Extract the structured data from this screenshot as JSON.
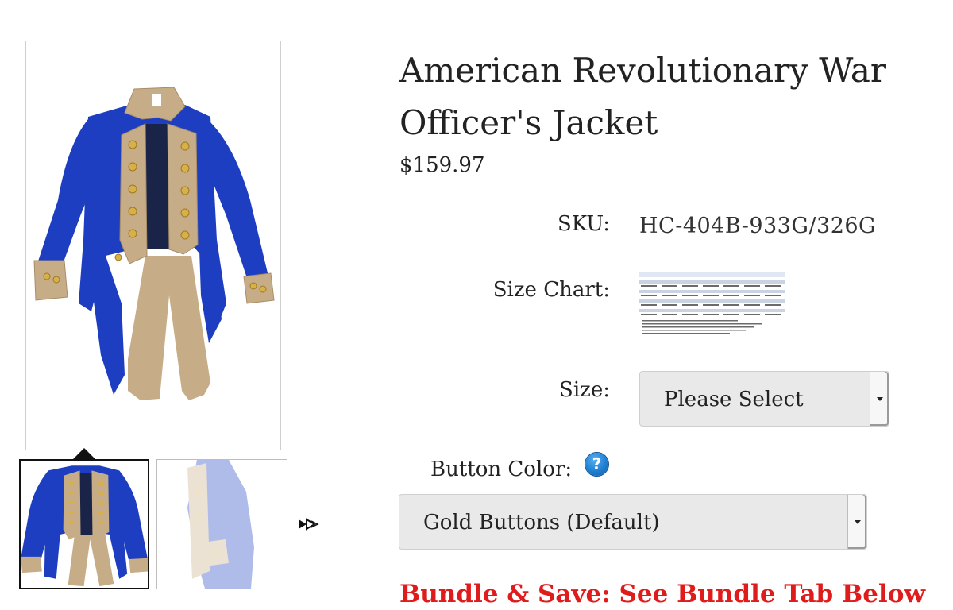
{
  "product": {
    "title": "American Revolutionary War Officer's Jacket",
    "price": "$159.97"
  },
  "options": {
    "sku_label": "SKU:",
    "sku_value": "HC-404B-933G/326G",
    "size_chart_label": "Size Chart:",
    "size_label": "Size:",
    "size_selected": "Please Select",
    "button_color_label": "Button Color:",
    "button_color_selected": "Gold Buttons (Default)",
    "help_glyph": "?"
  },
  "promo": {
    "bundle_text": "Bundle & Save: See Bundle Tab Below"
  },
  "colors": {
    "jacket_blue": "#1d3ec0",
    "facing_tan": "#c7ad87",
    "promo_red": "#e01b1b",
    "help_blue": "#1f7fd0"
  },
  "icons": {
    "next": "double-arrow-right-icon",
    "help": "question-circle-icon",
    "dropdown": "triangle-down-icon"
  }
}
